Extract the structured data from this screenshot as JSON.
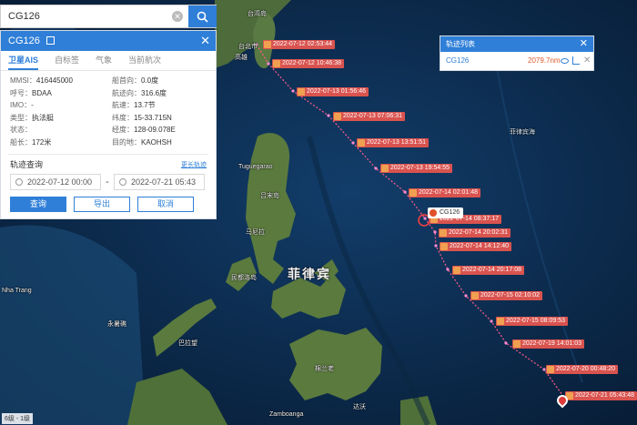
{
  "search": {
    "value": "CG126"
  },
  "panel": {
    "title": "CG126",
    "tabs": [
      "卫星AIS",
      "自标签",
      "气象",
      "当前航次"
    ],
    "info": [
      {
        "k": "MMSI：",
        "v": "416445000"
      },
      {
        "k": "船首向：",
        "v": "0.0度"
      },
      {
        "k": "呼号：",
        "v": "BDAA"
      },
      {
        "k": "航迹向：",
        "v": "316.6度"
      },
      {
        "k": "IMO：",
        "v": "-"
      },
      {
        "k": "航速：",
        "v": "13.7节"
      },
      {
        "k": "类型：",
        "v": "执法艇"
      },
      {
        "k": "纬度：",
        "v": "15-33.715N"
      },
      {
        "k": "状态：",
        "v": ""
      },
      {
        "k": "经度：",
        "v": "128-09.078E"
      },
      {
        "k": "船长：",
        "v": "172米"
      },
      {
        "k": "目的地：",
        "v": "KAOHSH"
      }
    ],
    "query_title": "轨迹查询",
    "query_link": "更长轨迹",
    "date_from": "2022-07-12 00:00",
    "date_sep": "-",
    "date_to": "2022-07-21 05:43",
    "btn_query": "查询",
    "btn_export": "导出",
    "btn_cancel": "取消"
  },
  "tracklist": {
    "title": "轨迹列表",
    "name": "CG126",
    "distance": "2079.7nm"
  },
  "ship_tag": "CG126",
  "map_labels": {
    "taiwan": "台湾岛",
    "taipei_city": "台北市",
    "kaohsiung": "高雄",
    "luzon": "吕宋岛",
    "philippines": "菲律宾",
    "manila": "马尼拉",
    "mindoro": "民都洛岛",
    "tuguegarao": "Tuguegarao",
    "philippine_sea": "菲律宾海",
    "nha_trang": "Nha Trang",
    "spratly": "永暑礁",
    "palawan": "巴拉望",
    "mindanao": "棉兰老",
    "davao": "达沃",
    "zamboanga": "Zamboanga",
    "scale": "6级 - 1级"
  },
  "track_points": [
    "2022-07-12 02:53:44",
    "2022-07-12 10:46:38",
    "2022-07-13 01:56:46",
    "2022-07-13 07:06:31",
    "2022-07-13 13:51:51",
    "2022-07-13 19:54:55",
    "2022-07-14 02:01:48",
    "2022-07-14 08:37:17",
    "2022-07-14 20:02:31",
    "2022-07-14 14:12:40",
    "2022-07-14 20:17:08",
    "2022-07-15 02:10:02",
    "2022-07-15 08:09:53",
    "2022-07-19 14:01:03",
    "2022-07-20 00:48:20",
    "2022-07-21 05:43:48"
  ],
  "colors": {
    "accent": "#2f7fd8",
    "track": "#e05a2b"
  }
}
